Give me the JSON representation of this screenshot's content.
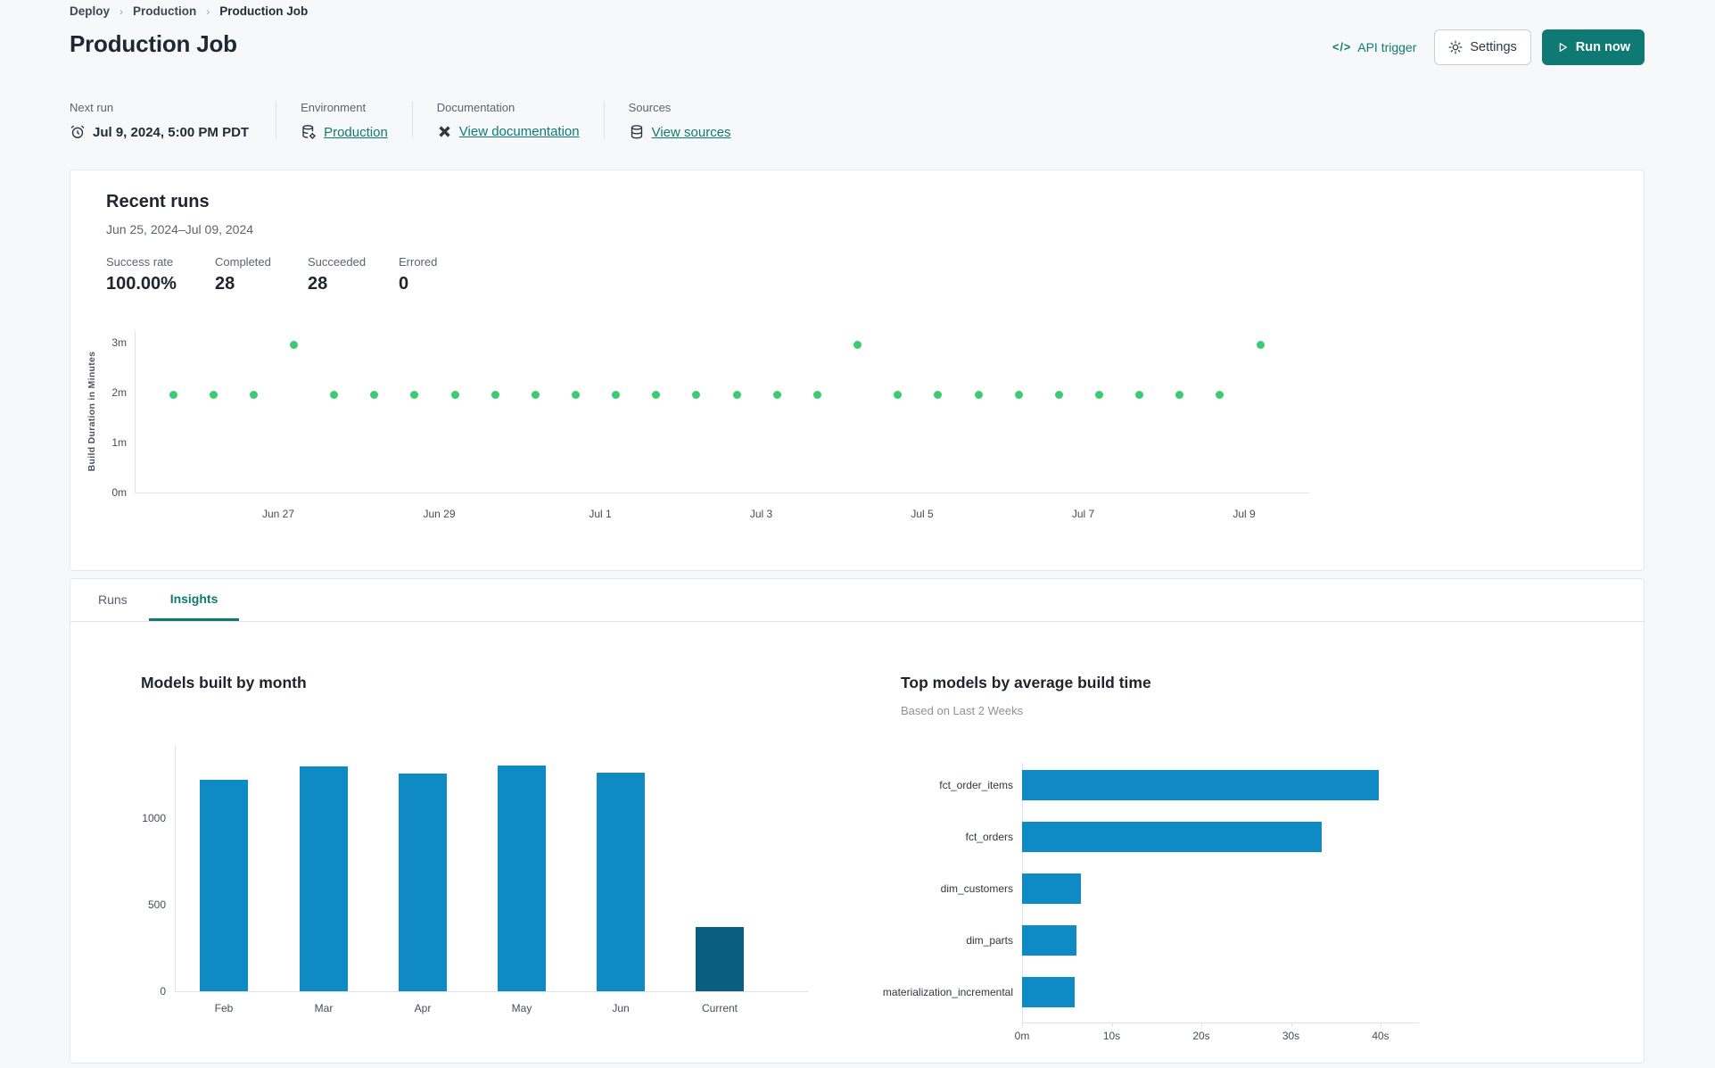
{
  "breadcrumb": {
    "items": [
      "Deploy",
      "Production",
      "Production Job"
    ],
    "separator": "›"
  },
  "header": {
    "title": "Production Job",
    "api_trigger_icon": "</>",
    "api_trigger_label": "API trigger",
    "settings_label": "Settings",
    "run_now_label": "Run now"
  },
  "info": {
    "next_run": {
      "label": "Next run",
      "value": "Jul 9, 2024, 5:00 PM PDT"
    },
    "environment": {
      "label": "Environment",
      "value": "Production"
    },
    "documentation": {
      "label": "Documentation",
      "value": "View documentation"
    },
    "sources": {
      "label": "Sources",
      "value": "View sources"
    }
  },
  "recent_runs": {
    "title": "Recent runs",
    "date_range": "Jun 25, 2024–Jul 09, 2024",
    "stats": [
      {
        "label": "Success rate",
        "value": "100.00%"
      },
      {
        "label": "Completed",
        "value": "28"
      },
      {
        "label": "Succeeded",
        "value": "28"
      },
      {
        "label": "Errored",
        "value": "0"
      }
    ]
  },
  "tabs": [
    {
      "label": "Runs",
      "active": false
    },
    {
      "label": "Insights",
      "active": true
    }
  ],
  "colors": {
    "accent": "#0e7a73",
    "green": "#3dcb72",
    "blue": "#108ac4",
    "dark_blue": "#0a5f80"
  },
  "chart_data": [
    {
      "id": "build-duration",
      "type": "scatter",
      "ylabel": "Build Duration in Minutes",
      "y_ticks": [
        "0m",
        "1m",
        "2m",
        "3m"
      ],
      "ylim": [
        0,
        3.3
      ],
      "x_ticks": [
        "Jun 27",
        "Jun 29",
        "Jul 1",
        "Jul 3",
        "Jul 5",
        "Jul 7",
        "Jul 9"
      ],
      "point_color": "#3dcb72",
      "points_minutes": [
        1.95,
        1.95,
        1.95,
        2.95,
        1.95,
        1.95,
        1.95,
        1.95,
        1.95,
        1.95,
        1.95,
        1.95,
        1.95,
        1.95,
        1.95,
        1.95,
        1.95,
        2.95,
        1.95,
        1.95,
        1.95,
        1.95,
        1.95,
        1.95,
        1.95,
        1.95,
        1.95,
        2.95
      ]
    },
    {
      "id": "models-built-by-month",
      "type": "bar",
      "title": "Models built by month",
      "categories": [
        "Feb",
        "Mar",
        "Apr",
        "May",
        "Jun",
        "Current"
      ],
      "values": [
        1220,
        1300,
        1260,
        1305,
        1265,
        370
      ],
      "y_ticks": [
        0,
        500,
        1000
      ],
      "ylim": [
        0,
        1400
      ],
      "grid": false,
      "bar_colors": [
        "#108ac4",
        "#108ac4",
        "#108ac4",
        "#108ac4",
        "#108ac4",
        "#0a5f80"
      ]
    },
    {
      "id": "top-models-by-average-build-time",
      "type": "bar",
      "orientation": "horizontal",
      "title": "Top models by average build time",
      "subtitle": "Based on Last 2 Weeks",
      "categories": [
        "fct_order_items",
        "fct_orders",
        "dim_customers",
        "dim_parts",
        "materialization_incremental"
      ],
      "values_seconds": [
        39.8,
        33.4,
        6.6,
        6.1,
        5.9
      ],
      "x_ticks": [
        "0m",
        "10s",
        "20s",
        "30s",
        "40s"
      ],
      "xlim": [
        0,
        44
      ],
      "grid": false,
      "bar_color": "#108ac4"
    }
  ]
}
